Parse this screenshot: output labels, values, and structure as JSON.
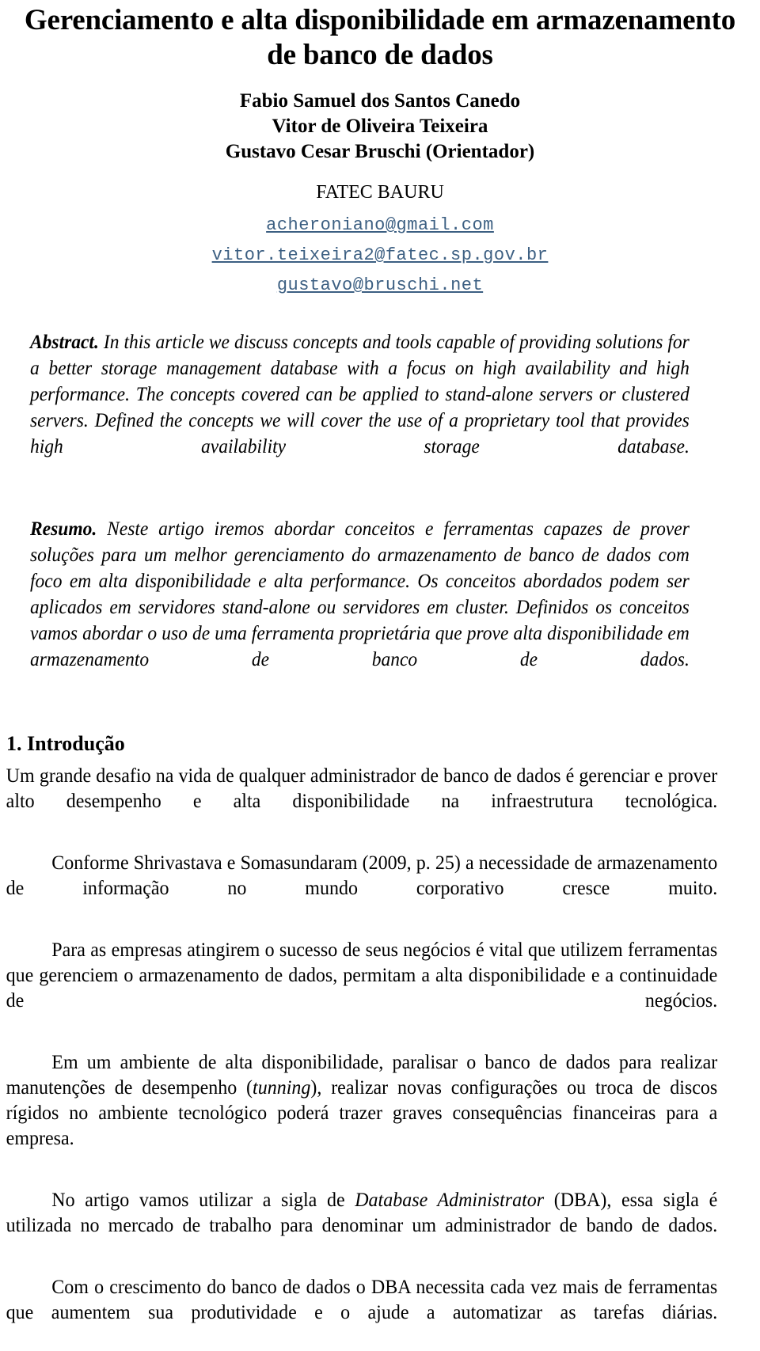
{
  "document": {
    "title": "Gerenciamento e alta disponibilidade em armazenamento de banco de dados",
    "authors": [
      "Fabio Samuel dos Santos Canedo",
      "Vitor de Oliveira Teixeira",
      "Gustavo Cesar Bruschi (Orientador)"
    ],
    "affiliation": "FATEC BAURU",
    "emails": [
      "acheroniano@gmail.com",
      "vitor.teixeira2@fatec.sp.gov.br",
      "gustavo@bruschi.net"
    ],
    "email_color": "#3c5f82",
    "abstract": {
      "label": "Abstract.",
      "text": " In this article we discuss concepts and tools capable of providing solutions for a better storage management database with a focus on high availability and high performance. The concepts covered can be applied to stand-alone servers or clustered servers. Defined the concepts we will cover the use of a proprietary tool that provides high availability storage database."
    },
    "resumo": {
      "label": "Resumo.",
      "text": " Neste artigo iremos abordar conceitos e ferramentas capazes de prover soluções para um melhor gerenciamento do armazenamento de banco de dados com foco em alta disponibilidade e alta performance. Os conceitos abordados podem ser aplicados em servidores stand-alone ou servidores em cluster. Definidos os conceitos vamos abordar o uso de uma ferramenta proprietária que prove alta disponibilidade em armazenamento de banco de dados."
    },
    "section": {
      "heading": "1. Introdução",
      "paragraphs": [
        {
          "indent": false,
          "parts": [
            {
              "style": "normal",
              "text": "Um grande desafio na vida de qualquer administrador de banco de dados é gerenciar e prover alto desempenho e alta disponibilidade na infraestrutura tecnológica."
            }
          ]
        },
        {
          "indent": true,
          "parts": [
            {
              "style": "normal",
              "text": "Conforme Shrivastava e Somasundaram (2009, p. 25) a necessidade de armazenamento de informação no mundo corporativo cresce muito."
            }
          ]
        },
        {
          "indent": true,
          "parts": [
            {
              "style": "normal",
              "text": "Para as empresas atingirem o sucesso de seus negócios é vital que utilizem ferramentas que gerenciem o armazenamento de dados, permitam a alta disponibilidade e a continuidade de negócios."
            }
          ]
        },
        {
          "indent": true,
          "parts": [
            {
              "style": "normal",
              "text": "Em um ambiente de alta disponibilidade, paralisar o banco de dados para realizar manutenções de desempenho ("
            },
            {
              "style": "italic",
              "text": "tunning"
            },
            {
              "style": "normal",
              "text": "), realizar novas configurações ou troca de discos rígidos no ambiente tecnológico poderá trazer graves consequências financeiras para a empresa."
            }
          ]
        },
        {
          "indent": true,
          "parts": [
            {
              "style": "normal",
              "text": "No artigo vamos utilizar a sigla de "
            },
            {
              "style": "italic",
              "text": "Database Administrator"
            },
            {
              "style": "normal",
              "text": " (DBA), essa sigla é utilizada no mercado de trabalho para denominar um administrador de bando de dados."
            }
          ]
        },
        {
          "indent": true,
          "parts": [
            {
              "style": "normal",
              "text": "Com o crescimento do banco de dados o DBA necessita cada vez mais de ferramentas que aumentem sua produtividade e o ajude a automatizar as tarefas diárias."
            }
          ]
        }
      ]
    }
  }
}
